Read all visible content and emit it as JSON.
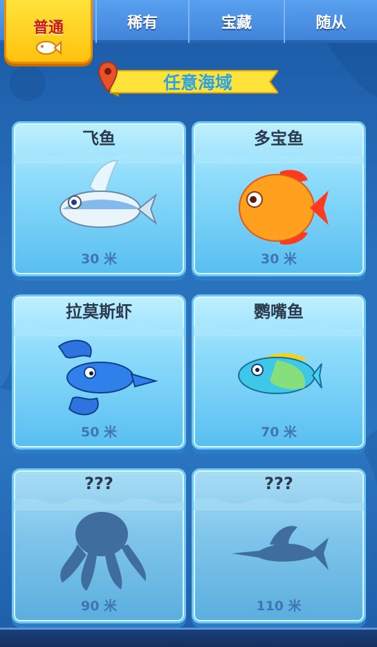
{
  "tabs": [
    {
      "label": "普通",
      "active": true,
      "icon": "fish-icon"
    },
    {
      "label": "稀有",
      "active": false
    },
    {
      "label": "宝藏",
      "active": false
    },
    {
      "label": "随从",
      "active": false
    }
  ],
  "banner": {
    "label": "任意海域",
    "icon": "location-pin-icon"
  },
  "cards": [
    {
      "name": "飞鱼",
      "distance": "30 米",
      "icon": "flying-fish-icon",
      "locked": false
    },
    {
      "name": "多宝鱼",
      "distance": "30 米",
      "icon": "orange-fish-icon",
      "locked": false
    },
    {
      "name": "拉莫斯虾",
      "distance": "50 米",
      "icon": "lobster-icon",
      "locked": false
    },
    {
      "name": "鹦嘴鱼",
      "distance": "70 米",
      "icon": "parrotfish-icon",
      "locked": false
    },
    {
      "name": "???",
      "distance": "90 米",
      "icon": "octopus-silhouette-icon",
      "locked": true
    },
    {
      "name": "???",
      "distance": "110 米",
      "icon": "swordfish-silhouette-icon",
      "locked": true
    }
  ],
  "colors": {
    "active_tab": "#ffc20f",
    "tab_bar": "#4a8fe2",
    "card": "#8fdcfb",
    "banner": "#ffe23a"
  }
}
